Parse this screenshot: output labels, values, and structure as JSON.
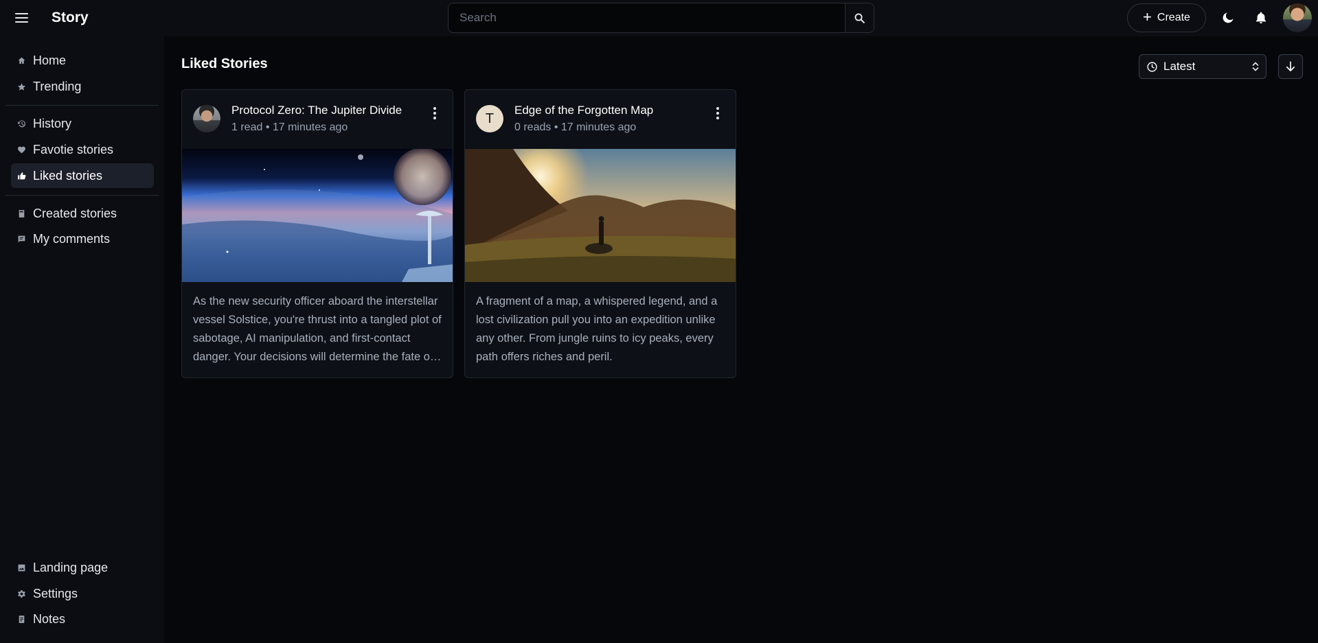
{
  "app": {
    "brand": "Story"
  },
  "header": {
    "search_placeholder": "Search",
    "create_label": "Create",
    "icons": [
      "menu-icon",
      "search-icon",
      "plus-icon",
      "moon-icon",
      "bell-icon",
      "avatar"
    ]
  },
  "sidebar": {
    "items": [
      {
        "label": "Home",
        "icon": "home-icon"
      },
      {
        "label": "Trending",
        "icon": "star-icon"
      },
      {
        "label": "History",
        "icon": "history-icon"
      },
      {
        "label": "Favotie stories",
        "icon": "heart-icon"
      },
      {
        "label": "Liked stories",
        "icon": "thumbs-up-icon",
        "active": true
      },
      {
        "label": "Created stories",
        "icon": "book-icon"
      },
      {
        "label": "My comments",
        "icon": "comment-icon"
      }
    ],
    "footer_items": [
      {
        "label": "Landing page",
        "icon": "image-icon"
      },
      {
        "label": "Settings",
        "icon": "gear-icon"
      },
      {
        "label": "Notes",
        "icon": "notes-icon"
      }
    ]
  },
  "main": {
    "title": "Liked Stories",
    "sort": {
      "selected": "Latest"
    },
    "cards": [
      {
        "title": "Protocol Zero: The Jupiter Divide",
        "meta": "1 read • 17 minutes ago",
        "avatar_letter": "",
        "description": "As the new security officer aboard the interstellar vessel Solstice, you're thrust into a tangled plot of sabotage, AI manipulation, and first-contact danger. Your decisions will determine the fate of the crew."
      },
      {
        "title": "Edge of the Forgotten Map",
        "meta": "0 reads • 17 minutes ago",
        "avatar_letter": "T",
        "description": "A fragment of a map, a whispered legend, and a lost civilization pull you into an expedition unlike any other. From jungle ruins to icy peaks, every path offers riches and peril."
      }
    ]
  },
  "colors": {
    "background": "#06070a",
    "panel": "#0b0d12",
    "active": "#1c202a",
    "muted_text": "#9aa3b2"
  }
}
